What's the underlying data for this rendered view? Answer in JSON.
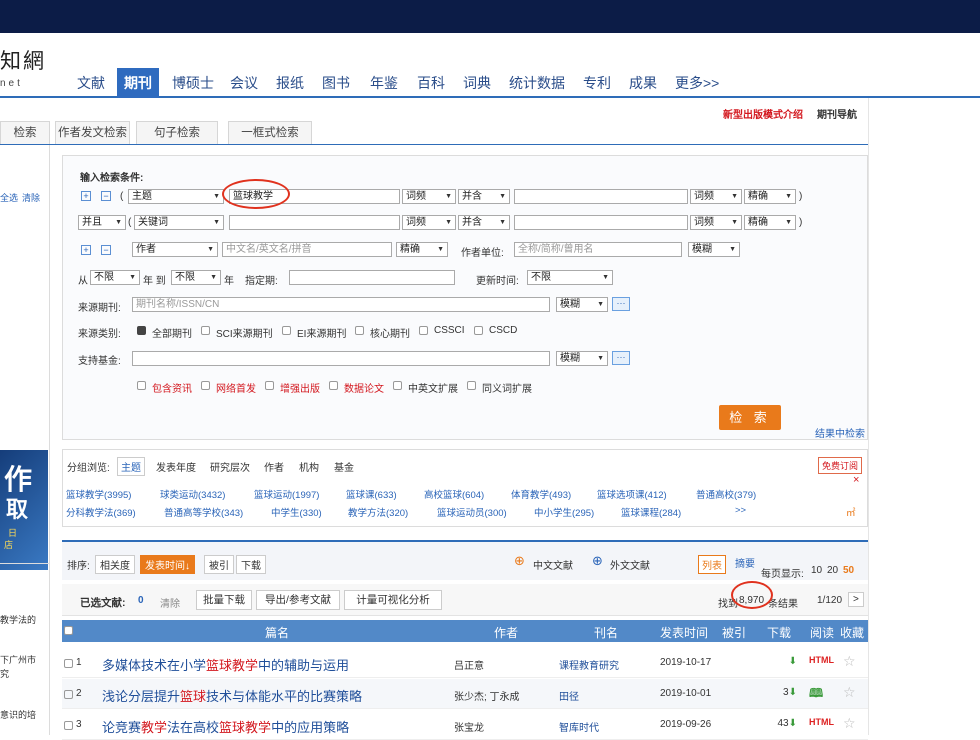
{
  "logo": {
    "text": "知網",
    "sub": "net"
  },
  "nav": [
    "文献",
    "期刊",
    "博硕士",
    "会议",
    "报纸",
    "图书",
    "年鉴",
    "百科",
    "词典",
    "统计数据",
    "专利",
    "成果",
    "更多>>"
  ],
  "nav_active": "期刊",
  "header_right": {
    "link1": "新型出版模式介绍",
    "link2": "期刊导航"
  },
  "tabs": [
    "检索",
    "作者发文检索",
    "句子检索",
    "一框式检索"
  ],
  "left": {
    "select_all": "全选",
    "clear": "清除",
    "ad": "作",
    "ad2": "取",
    "ad3": "日",
    "ad4": "店",
    "side1": "教学法的",
    "side2": "下广州市",
    "side3": "究",
    "side4": "意识的培"
  },
  "search": {
    "title": "输入检索条件:",
    "row1": {
      "field": "主题",
      "value": "篮球教学",
      "freq": "词频",
      "bool": "并含",
      "freq2": "词频",
      "match": "精确",
      "paren_open": "(",
      "paren_close": ")"
    },
    "row2": {
      "logic": "并且",
      "field": "关键词",
      "freq": "词频",
      "bool": "并含",
      "freq2": "词频",
      "match": "精确",
      "paren_open": "(",
      "paren_close": ")"
    },
    "row3": {
      "field": "作者",
      "placeholder": "中文名/英文名/拼音",
      "match": "精确",
      "unit_label": "作者单位:",
      "unit_placeholder": "全称/简称/曾用名",
      "match2": "模糊"
    },
    "row4": {
      "from": "从",
      "y1": "不限",
      "year_to": "年 到",
      "y2": "不限",
      "year": "年",
      "date_label": "指定期:",
      "update_label": "更新时间:",
      "update_val": "不限"
    },
    "row5": {
      "label": "来源期刊:",
      "placeholder": "期刊名称/ISSN/CN",
      "match": "模糊",
      "dots": "···"
    },
    "row6": {
      "label": "来源类别:",
      "opts": [
        "全部期刊",
        "SCI来源期刊",
        "EI来源期刊",
        "核心期刊",
        "CSSCI",
        "CSCD"
      ]
    },
    "row7": {
      "label": "支持基金:",
      "match": "模糊",
      "dots": "···"
    },
    "row8": {
      "opts": [
        "包含资讯",
        "网络首发",
        "增强出版",
        "数据论文",
        "中英文扩展",
        "同义词扩展"
      ]
    },
    "button": "检 索",
    "in_results": "结果中检索"
  },
  "group": {
    "label": "分组浏览:",
    "tabs": [
      "主题",
      "发表年度",
      "研究层次",
      "作者",
      "机构",
      "基金"
    ],
    "subscribe": "免费订阅",
    "close": "×",
    "row1": [
      "篮球教学(3995)",
      "球类运动(3432)",
      "篮球运动(1997)",
      "篮球课(633)",
      "高校篮球(604)",
      "体育教学(493)",
      "篮球选项课(412)",
      "普通高校(379)"
    ],
    "row2": [
      "分科教学法(369)",
      "普通高等学校(343)",
      "中学生(330)",
      "教学方法(320)",
      "篮球运动员(300)",
      "中小学生(295)",
      "篮球课程(284)",
      ">>"
    ],
    "chart_icon": "㎡"
  },
  "sort": {
    "label": "排序:",
    "items": [
      "相关度",
      "发表时间↓",
      "被引",
      "下载"
    ],
    "cn": "中文文献",
    "en": "外文文献",
    "list": "列表",
    "abstract": "摘要",
    "per_page_label": "每页显示:",
    "per_page": [
      "10",
      "20",
      "50"
    ]
  },
  "selected": {
    "label": "已选文献:",
    "count": "0",
    "clear": "清除",
    "btns": [
      "批量下载",
      "导出/参考文献",
      "计量可视化分析"
    ],
    "found_prefix": "找到",
    "found": "8,970",
    "found_suffix": "条结果",
    "page": "1/120",
    "next": ">"
  },
  "table": {
    "headers": [
      "篇名",
      "作者",
      "刊名",
      "发表时间",
      "被引",
      "下载",
      "阅读",
      "收藏"
    ],
    "rows": [
      {
        "num": "1",
        "title_parts": [
          "多媒体技术在小学",
          "篮球教学",
          "中的辅助与运用"
        ],
        "author": "吕正意",
        "journal": "课程教育研究",
        "date": "2019-10-17",
        "downloads": "",
        "read": "HTML"
      },
      {
        "num": "2",
        "title_parts": [
          "浅论分层提升",
          "篮球",
          "技术与体能水平的比赛策略"
        ],
        "author": "张少杰; 丁永成",
        "journal": "田径",
        "date": "2019-10-01",
        "downloads": "3",
        "read": "□"
      },
      {
        "num": "3",
        "title_parts": [
          "论竞赛",
          "教学",
          "法在高校",
          "篮球教学",
          "中的应用策略"
        ],
        "author": "张宝龙",
        "journal": "智库时代",
        "date": "2019-09-26",
        "downloads": "43",
        "read": "HTML"
      }
    ]
  }
}
